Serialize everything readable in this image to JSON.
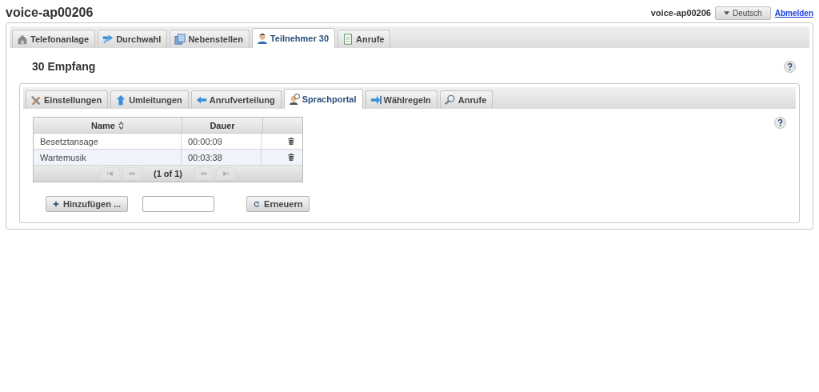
{
  "header": {
    "title": "voice-ap00206",
    "user": "voice-ap00206",
    "language": "Deutsch",
    "logout": "Abmelden"
  },
  "tabs": [
    {
      "label": "Telefonanlage",
      "selected": false
    },
    {
      "label": "Durchwahl",
      "selected": false
    },
    {
      "label": "Nebenstellen",
      "selected": false
    },
    {
      "label": "Teilnehmer 30",
      "selected": true
    },
    {
      "label": "Anrufe",
      "selected": false
    }
  ],
  "section_title": "30 Empfang",
  "subtabs": [
    {
      "label": "Einstellungen",
      "selected": false
    },
    {
      "label": "Umleitungen",
      "selected": false
    },
    {
      "label": "Anrufverteilung",
      "selected": false
    },
    {
      "label": "Sprachportal",
      "selected": true
    },
    {
      "label": "Wählregeln",
      "selected": false
    },
    {
      "label": "Anrufe",
      "selected": false
    }
  ],
  "table": {
    "columns": [
      "Name",
      "Dauer"
    ],
    "rows": [
      {
        "name": "Besetztansage",
        "duration": "00:00:09"
      },
      {
        "name": "Wartemusik",
        "duration": "00:03:38"
      }
    ],
    "pager": {
      "text": "(1 of 1)",
      "disabled": true
    }
  },
  "add_button": "Hinzufügen ...",
  "refresh_button": "Erneuern"
}
